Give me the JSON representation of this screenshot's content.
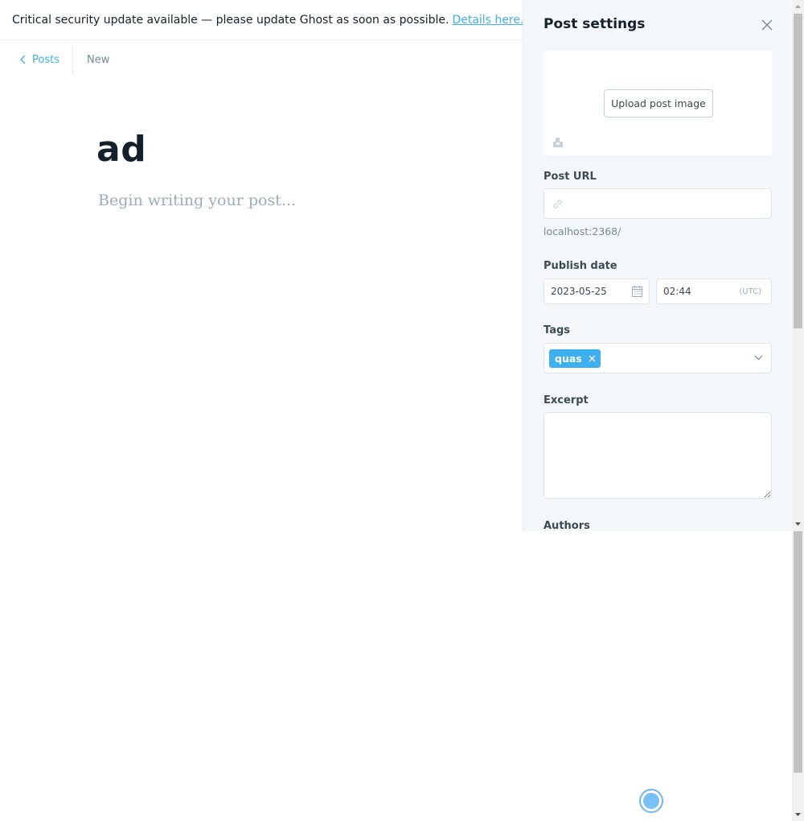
{
  "banner": {
    "message": "Critical security update available — please update Ghost as soon as possible.",
    "link_label": "Details here."
  },
  "nav": {
    "back_label": "Posts",
    "status": "New"
  },
  "editor": {
    "title": "ad",
    "body_placeholder": "Begin writing your post..."
  },
  "settings": {
    "title": "Post settings",
    "upload_label": "Upload post image",
    "post_url_label": "Post URL",
    "post_url_value": "",
    "post_url_hint": "localhost:2368/",
    "publish_date_label": "Publish date",
    "date_value": "2023-05-25",
    "time_value": "02:44",
    "timezone": "(UTC)",
    "tags_label": "Tags",
    "tags": [
      "quas"
    ],
    "excerpt_label": "Excerpt",
    "excerpt_value": "",
    "authors_label": "Authors"
  },
  "colors": {
    "accent": "#3eb0ef",
    "panel_bg": "#f4f8fb"
  }
}
